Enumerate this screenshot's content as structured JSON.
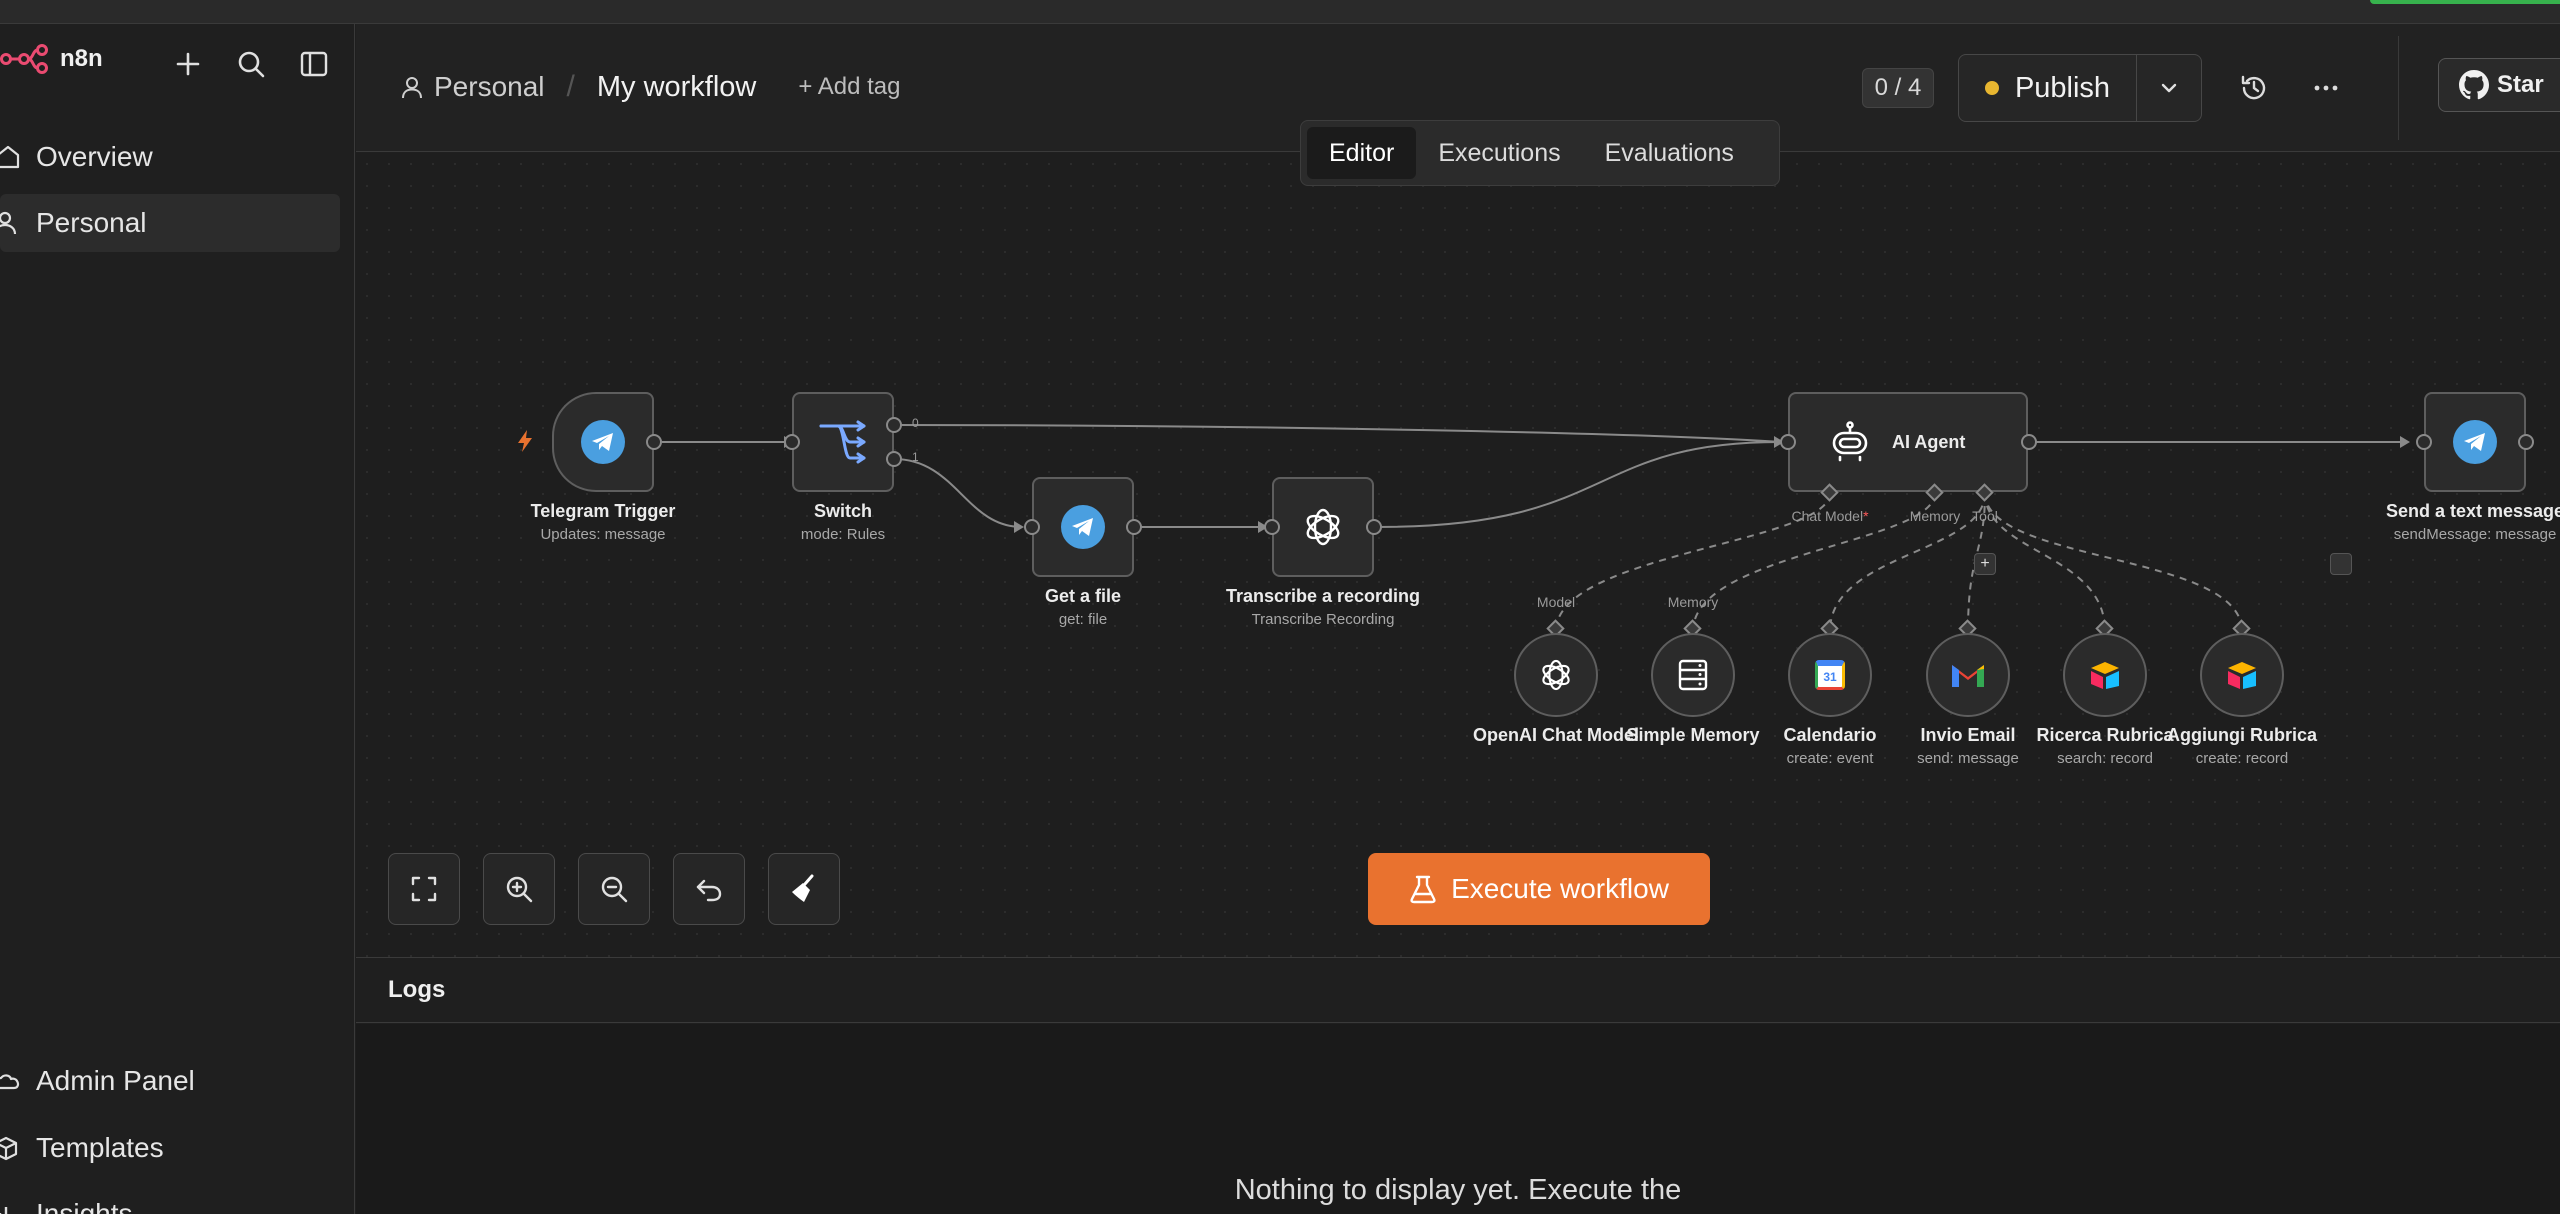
{
  "app": {
    "name": "n8n"
  },
  "sidebar": {
    "items": [
      {
        "label": "Overview"
      },
      {
        "label": "Personal"
      }
    ],
    "bottom_items": [
      {
        "label": "Admin Panel"
      },
      {
        "label": "Templates"
      },
      {
        "label": "Insights"
      }
    ]
  },
  "header": {
    "project": "Personal",
    "workflow_name": "My workflow",
    "add_tag": "+ Add tag",
    "counter": "0 / 4",
    "publish_label": "Publish",
    "star_label": "Star"
  },
  "tabs": [
    {
      "label": "Editor",
      "active": true
    },
    {
      "label": "Executions",
      "active": false
    },
    {
      "label": "Evaluations",
      "active": false
    }
  ],
  "nodes": {
    "telegram_trigger": {
      "label": "Telegram Trigger",
      "sub": "Updates: message"
    },
    "switch": {
      "label": "Switch",
      "sub": "mode: Rules",
      "out0": "0",
      "out1": "1"
    },
    "get_file": {
      "label": "Get a file",
      "sub": "get: file"
    },
    "transcribe": {
      "label": "Transcribe a recording",
      "sub": "Transcribe Recording"
    },
    "ai_agent": {
      "label": "AI Agent",
      "port_chat_model": "Chat Model",
      "required_mark": "*",
      "port_memory": "Memory",
      "port_tool": "Tool"
    },
    "send_message": {
      "label": "Send a text message",
      "sub": "sendMessage: message"
    },
    "openai_model": {
      "label": "OpenAI Chat Model",
      "port": "Model"
    },
    "simple_memory": {
      "label": "Simple Memory",
      "port": "Memory"
    },
    "calendario": {
      "label": "Calendario",
      "sub": "create: event",
      "icon_text": "31"
    },
    "invio_email": {
      "label": "Invio Email",
      "sub": "send: message"
    },
    "ricerca_rubrica": {
      "label": "Ricerca Rubrica",
      "sub": "search: record"
    },
    "aggiungi_rubrica": {
      "label": "Aggiungi Rubrica",
      "sub": "create: record"
    }
  },
  "canvas": {
    "execute_label": "Execute workflow",
    "tool_add": "+"
  },
  "logs": {
    "title": "Logs",
    "empty": "Nothing to display yet. Execute the"
  },
  "colors": {
    "accent_orange": "#e9722f",
    "telegram_blue": "#4a9fe0",
    "publish_dot": "#e8b630",
    "logo_pink": "#ea4b71"
  }
}
